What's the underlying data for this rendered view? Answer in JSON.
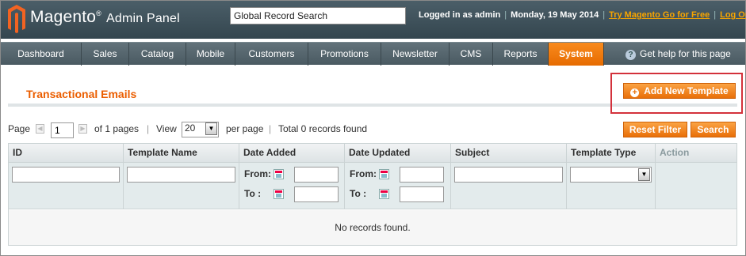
{
  "header": {
    "brand": "Magento",
    "brand_sub": "Admin Panel",
    "search_value": "Global Record Search",
    "logged_in": "Logged in as admin",
    "date": "Monday, 19 May 2014",
    "try_link": "Try Magento Go for Free",
    "logout": "Log Out"
  },
  "nav": {
    "items": [
      "Dashboard",
      "Sales",
      "Catalog",
      "Mobile",
      "Customers",
      "Promotions",
      "Newsletter",
      "CMS",
      "Reports",
      "System"
    ],
    "active": "System",
    "help": "Get help for this page"
  },
  "page": {
    "title": "Transactional Emails",
    "add_button": "Add New Template",
    "reset_button": "Reset Filter",
    "search_button": "Search"
  },
  "pager": {
    "page_label": "Page",
    "page_value": "1",
    "of_pages": "of 1 pages",
    "view_label": "View",
    "per_page_value": "20",
    "per_page_label": "per page",
    "total": "Total 0 records found"
  },
  "grid": {
    "columns": [
      "ID",
      "Template Name",
      "Date Added",
      "Date Updated",
      "Subject",
      "Template Type",
      "Action"
    ],
    "from_label": "From:",
    "to_label": "To :",
    "empty": "No records found."
  },
  "colors": {
    "accent": "#eb5e00",
    "header_bg": "#3a4d57",
    "highlight": "#d3313b"
  }
}
